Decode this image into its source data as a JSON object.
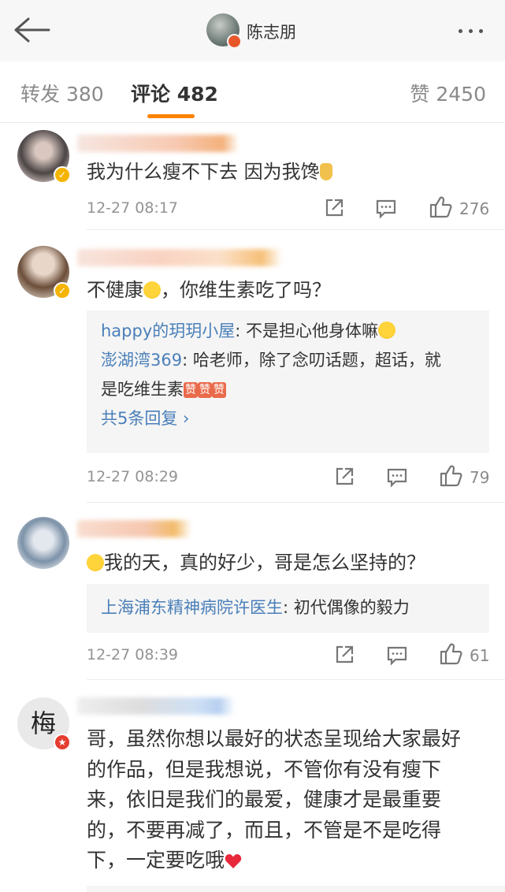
{
  "header": {
    "author": "陈志朋"
  },
  "tabs": {
    "repost": "转发 380",
    "comment": "评论 482",
    "like": "赞 2450"
  },
  "comments": [
    {
      "text": "我为什么瘦不下去 因为我馋",
      "time": "12-27 08:17",
      "likes": "276",
      "badge": "verified-gold"
    },
    {
      "text": "不健康",
      "text_after": "，你维生素吃了吗？",
      "time": "12-27 08:29",
      "likes": "79",
      "badge": "verified-gold",
      "replies": [
        {
          "who": "happy的玥玥小屋",
          "text": ": 不是担心他身体嘛"
        },
        {
          "who": "澎湖湾369",
          "text": ": 哈老师，除了念叨话题，超话，就",
          "text2": "是吃维生素",
          "zan": "赞"
        }
      ],
      "reply_more": "共5条回复 ›"
    },
    {
      "text": "我的天，真的好少，哥是怎么坚持的？",
      "time": "12-27 08:39",
      "likes": "61",
      "replies": [
        {
          "who": "上海浦东精神病院许医生",
          "text": ": 初代偶像的毅力"
        }
      ]
    },
    {
      "avatar_text": "梅",
      "badge": "verified-red",
      "lines": [
        "哥，虽然你想以最好的状态呈现给大家最好",
        "的作品，但是我想说，不管你有没有瘦下",
        "来，依旧是我们的最爱，健康才是最重要",
        "的，不要再减了，而且，不管是不是吃得",
        "下，一定要吃哦"
      ]
    }
  ]
}
